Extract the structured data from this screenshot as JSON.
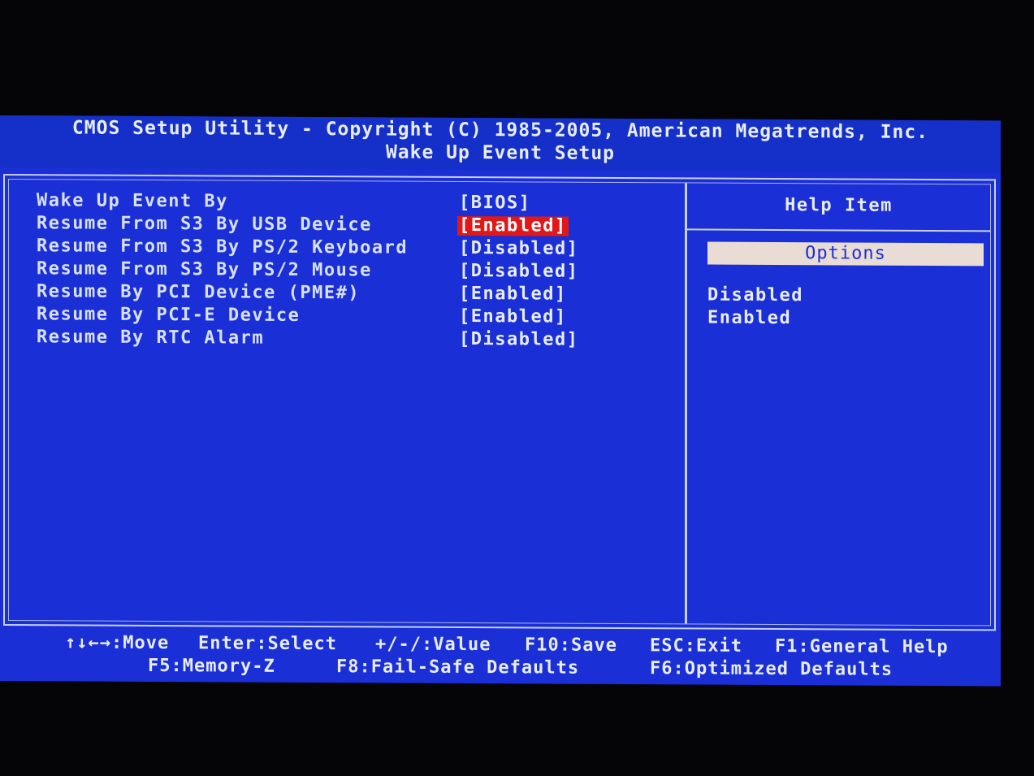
{
  "header": {
    "title": "CMOS Setup Utility - Copyright (C) 1985-2005, American Megatrends, Inc.",
    "subtitle": "Wake Up Event Setup"
  },
  "settings": [
    {
      "label": "Wake Up Event By",
      "value": "[BIOS]",
      "selected": false
    },
    {
      "label": "Resume From S3 By USB Device",
      "value": "[Enabled]",
      "selected": true
    },
    {
      "label": "Resume From S3 By PS/2 Keyboard",
      "value": "[Disabled]",
      "selected": false
    },
    {
      "label": "Resume From S3 By PS/2 Mouse",
      "value": "[Disabled]",
      "selected": false
    },
    {
      "label": "Resume By PCI Device (PME#)",
      "value": "[Enabled]",
      "selected": false
    },
    {
      "label": "Resume By PCI-E Device",
      "value": "[Enabled]",
      "selected": false
    },
    {
      "label": "Resume By RTC Alarm",
      "value": "[Disabled]",
      "selected": false
    }
  ],
  "help": {
    "title": "Help Item",
    "options_header": "Options",
    "options": [
      "Disabled",
      "Enabled"
    ]
  },
  "footer": {
    "row1": [
      "↑↓←→:Move",
      "Enter:Select",
      "+/-/:Value",
      "F10:Save",
      "ESC:Exit",
      "F1:General Help"
    ],
    "row2": [
      "F5:Memory-Z",
      "F8:Fail-Safe Defaults",
      "F6:Optimized Defaults"
    ]
  },
  "colors": {
    "background": "#1a2fd6",
    "highlight": "#e01818",
    "options_bar": "#e8dcd4",
    "text": "#e8ecf8"
  }
}
